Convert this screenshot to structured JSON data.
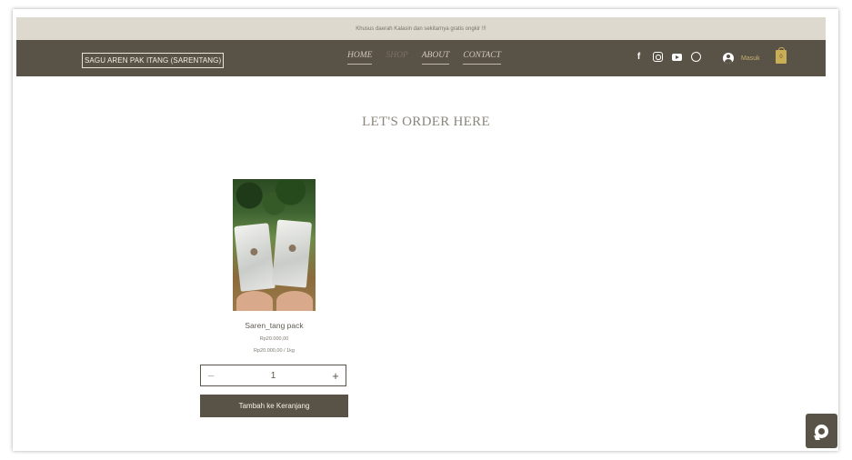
{
  "promo": {
    "text": "Khusus daerah Kalasin dan sekitarnya gratis ongkir !!!"
  },
  "header": {
    "brand": "SAGU AREN PAK ITANG (SARENTANG)",
    "menu": [
      {
        "label": "HOME",
        "active": false
      },
      {
        "label": "SHOP",
        "active": true
      },
      {
        "label": "ABOUT",
        "active": false
      },
      {
        "label": "CONTACT",
        "active": false
      }
    ],
    "social_icons": [
      "facebook-icon",
      "instagram-icon",
      "youtube-icon",
      "whatsapp-icon"
    ],
    "login_label": "Masuk",
    "cart_count": "0"
  },
  "main": {
    "title": "LET'S ORDER HERE",
    "product": {
      "name": "Saren_tang pack",
      "price": "Rp20.000,00",
      "unit_price": "Rp20.000,00 / 1kg",
      "quantity": "1",
      "add_to_cart_label": "Tambah ke Keranjang"
    }
  },
  "colors": {
    "nav_bg": "#595246",
    "promo_bg": "#ddd9cf",
    "accent_gold": "#c9ae55"
  }
}
